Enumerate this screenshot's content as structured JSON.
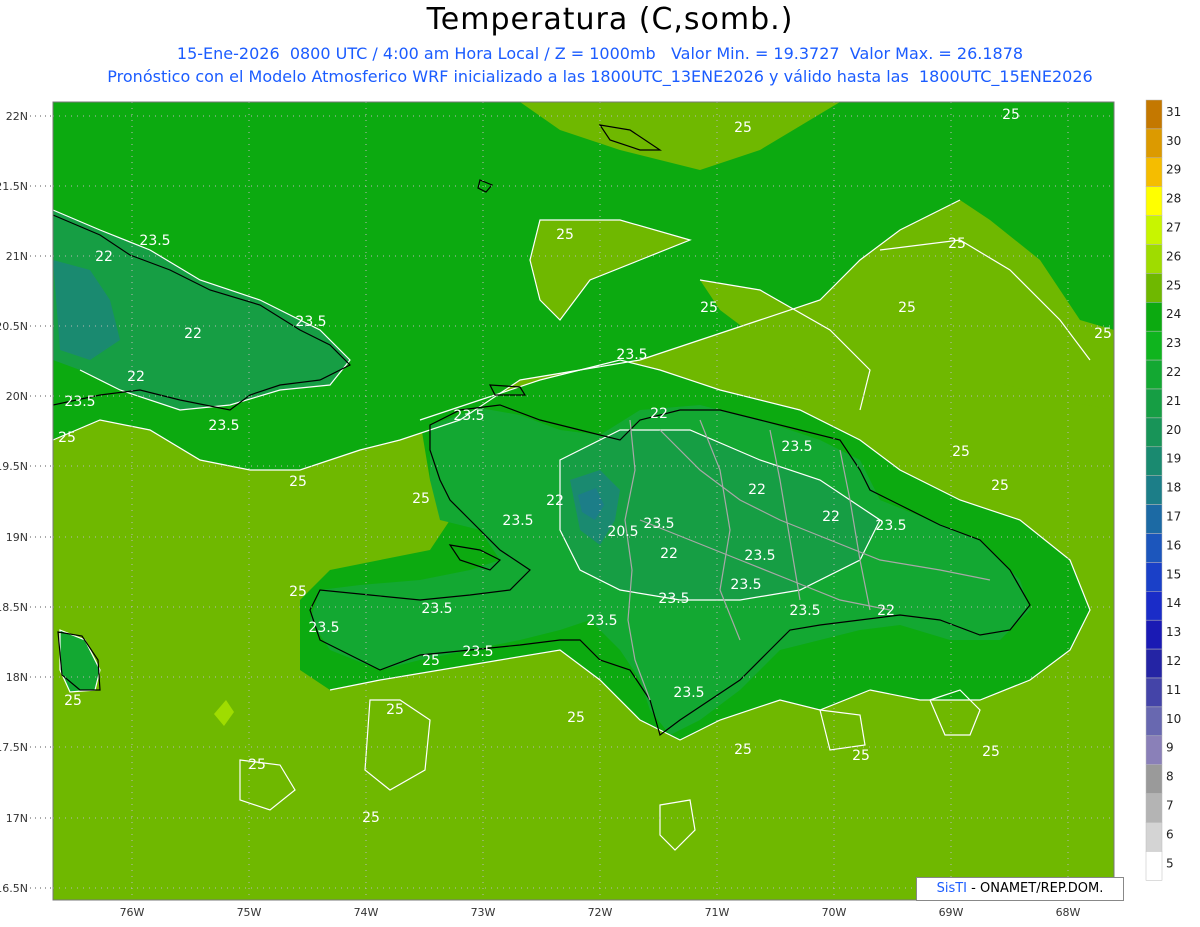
{
  "header": {
    "title": "Temperatura (C,somb.)",
    "line1": "15-Ene-2026  0800 UTC / 4:00 am Hora Local / Z = 1000mb   Valor Min. = 19.3727  Valor Max. = 26.1878",
    "line2": "Pronóstico con el Modelo Atmosferico WRF inicializado a las 1800UTC_13ENE2026 y válido hasta las  1800UTC_15ENE2026"
  },
  "credit": {
    "brand": "SisTI",
    "text": " - ONAMET/REP.DOM."
  },
  "map": {
    "lat_labels": [
      "22N",
      "21.5N",
      "21N",
      "20.5N",
      "20N",
      "19.5N",
      "19N",
      "18.5N",
      "18N",
      "17.5N",
      "17N",
      "16.5N"
    ],
    "lon_labels": [
      "76W",
      "75W",
      "74W",
      "73W",
      "72W",
      "71W",
      "70W",
      "69W",
      "68W"
    ],
    "contour_labels": [
      {
        "text": "25"
      },
      {
        "text": "25"
      },
      {
        "text": "23.5"
      },
      {
        "text": "22"
      },
      {
        "text": "22"
      },
      {
        "text": "23.5"
      },
      {
        "text": "22"
      },
      {
        "text": "23.5"
      },
      {
        "text": "25"
      },
      {
        "text": "23.5"
      },
      {
        "text": "25"
      },
      {
        "text": "25"
      },
      {
        "text": "25"
      },
      {
        "text": "25"
      },
      {
        "text": "25"
      },
      {
        "text": "23.5"
      },
      {
        "text": "23.5"
      },
      {
        "text": "22"
      },
      {
        "text": "23.5"
      },
      {
        "text": "22"
      },
      {
        "text": "23.5"
      },
      {
        "text": "22"
      },
      {
        "text": "20.5"
      },
      {
        "text": "23.5"
      },
      {
        "text": "22"
      },
      {
        "text": "23.5"
      },
      {
        "text": "22"
      },
      {
        "text": "23.5"
      },
      {
        "text": "23.5"
      },
      {
        "text": "23.5"
      },
      {
        "text": "23.5"
      },
      {
        "text": "23.5"
      },
      {
        "text": "23.5"
      },
      {
        "text": "22"
      },
      {
        "text": "23.5"
      },
      {
        "text": "25"
      },
      {
        "text": "25"
      },
      {
        "text": "25"
      },
      {
        "text": "25"
      },
      {
        "text": "25"
      },
      {
        "text": "25"
      },
      {
        "text": "25"
      },
      {
        "text": "25"
      },
      {
        "text": "25"
      },
      {
        "text": "25"
      },
      {
        "text": "23.5"
      },
      {
        "text": "25"
      },
      {
        "text": "25"
      },
      {
        "text": "25"
      },
      {
        "text": "25"
      },
      {
        "text": "23.5"
      }
    ]
  },
  "legend": {
    "levels": [
      "31",
      "30",
      "29",
      "28",
      "27",
      "26",
      "25",
      "24",
      "23",
      "22",
      "21",
      "20",
      "19",
      "18",
      "17",
      "16",
      "15",
      "14",
      "13",
      "12",
      "11",
      "10",
      "9",
      "8",
      "7",
      "6",
      "5"
    ],
    "colors": [
      "#c47800",
      "#dc9a00",
      "#f5bd00",
      "#ffff00",
      "#c8f500",
      "#9fdc00",
      "#6fb800",
      "#0caa10",
      "#0fb41e",
      "#13a832",
      "#169e44",
      "#189458",
      "#1a8a70",
      "#1c7e88",
      "#1c6aa4",
      "#1c56bc",
      "#1a40c8",
      "#1a2cc8",
      "#1a1ab4",
      "#2424a4",
      "#4444a8",
      "#6868b0",
      "#8a80b8",
      "#9a9a9a",
      "#b4b4b4",
      "#d4d4d4",
      "#ffffff"
    ]
  },
  "colors": {
    "ocean": "#6fb800",
    "land": "#13a832",
    "cool": "#1a8a70",
    "contour": "#ffffff",
    "title_blue": "#1b5cff"
  }
}
